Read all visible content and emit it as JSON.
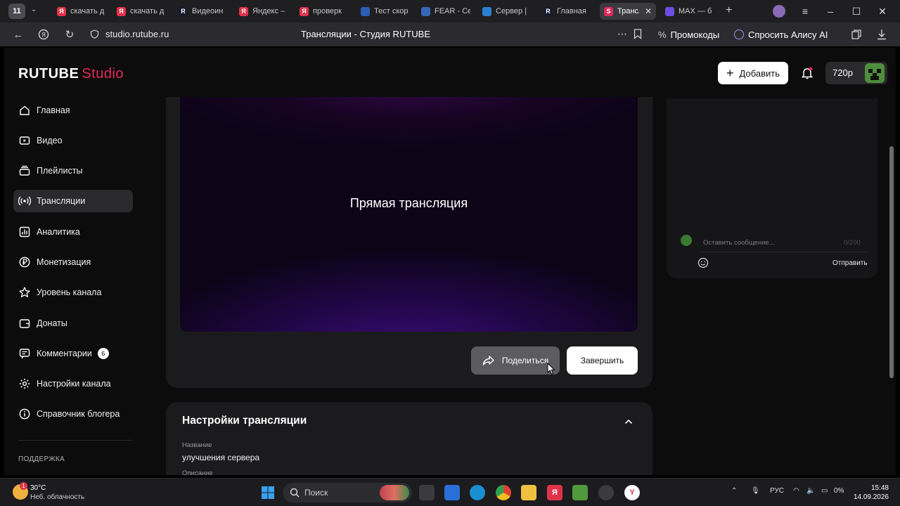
{
  "browser": {
    "tab_count": "11",
    "tabs": [
      {
        "title": "скачать д",
        "fav_color": "#e0334a",
        "fav": "Я"
      },
      {
        "title": "скачать д",
        "fav_color": "#e0334a",
        "fav": "Я"
      },
      {
        "title": "Видеоин",
        "fav_color": "#1a1a2e",
        "fav": "R"
      },
      {
        "title": "Яндекс –",
        "fav_color": "#e0334a",
        "fav": "Я"
      },
      {
        "title": "проверк",
        "fav_color": "#e0334a",
        "fav": "Я"
      },
      {
        "title": "Тест скор",
        "fav_color": "#2b5fb3",
        "fav": ""
      },
      {
        "title": "FEAR - Се",
        "fav_color": "#3566b8",
        "fav": ""
      },
      {
        "title": "Сервер |",
        "fav_color": "#2a7fd0",
        "fav": ""
      },
      {
        "title": "Главная",
        "fav_color": "#1a1a2e",
        "fav": "R"
      },
      {
        "title": "Трансл",
        "fav_color": "#e0285a",
        "fav": "S"
      },
      {
        "title": "MAX — б",
        "fav_color": "#6b4de0",
        "fav": ""
      }
    ],
    "url": "studio.rutube.ru",
    "page_title": "Трансляции - Студия RUTUBE",
    "promo_label": "Промокоды",
    "alice_label": "Спросить Алису AI"
  },
  "header": {
    "logo_main": "RUTUBE",
    "logo_sub": "Studio",
    "add_label": "Добавить",
    "quality": "720p"
  },
  "sidebar": {
    "items": [
      {
        "label": "Главная",
        "icon": "home-icon"
      },
      {
        "label": "Видео",
        "icon": "video-icon"
      },
      {
        "label": "Плейлисты",
        "icon": "playlist-icon"
      },
      {
        "label": "Трансляции",
        "icon": "broadcast-icon",
        "active": true
      },
      {
        "label": "Аналитика",
        "icon": "analytics-icon"
      },
      {
        "label": "Монетизация",
        "icon": "ruble-icon"
      },
      {
        "label": "Уровень канала",
        "icon": "star-icon"
      },
      {
        "label": "Донаты",
        "icon": "wallet-icon"
      },
      {
        "label": "Комментарии",
        "icon": "comment-icon",
        "badge": "6"
      },
      {
        "label": "Настройки канала",
        "icon": "gear-icon"
      },
      {
        "label": "Справочник блогера",
        "icon": "info-icon"
      }
    ],
    "support_label": "ПОДДЕРЖКА"
  },
  "player": {
    "live_label": "Прямая трансляция",
    "share_label": "Поделиться",
    "end_label": "Завершить"
  },
  "chat": {
    "placeholder": "Оставить сообщение...",
    "counter": "0/200",
    "send_label": "Отправить"
  },
  "settings": {
    "title": "Настройки трансляции",
    "name_label": "Название",
    "name_value": "улучшения сервера",
    "desc_label": "Описание"
  },
  "taskbar": {
    "weather_badge": "1",
    "temperature": "30°C",
    "weather_desc": "Неб. облачность",
    "search_label": "Поиск",
    "lang": "РУС",
    "battery": "0%",
    "time": "15:48",
    "date": "14.09.2026"
  },
  "colors": {
    "accent": "#e6285a",
    "background": "#0c0c0d",
    "card": "#1b1b1d"
  }
}
